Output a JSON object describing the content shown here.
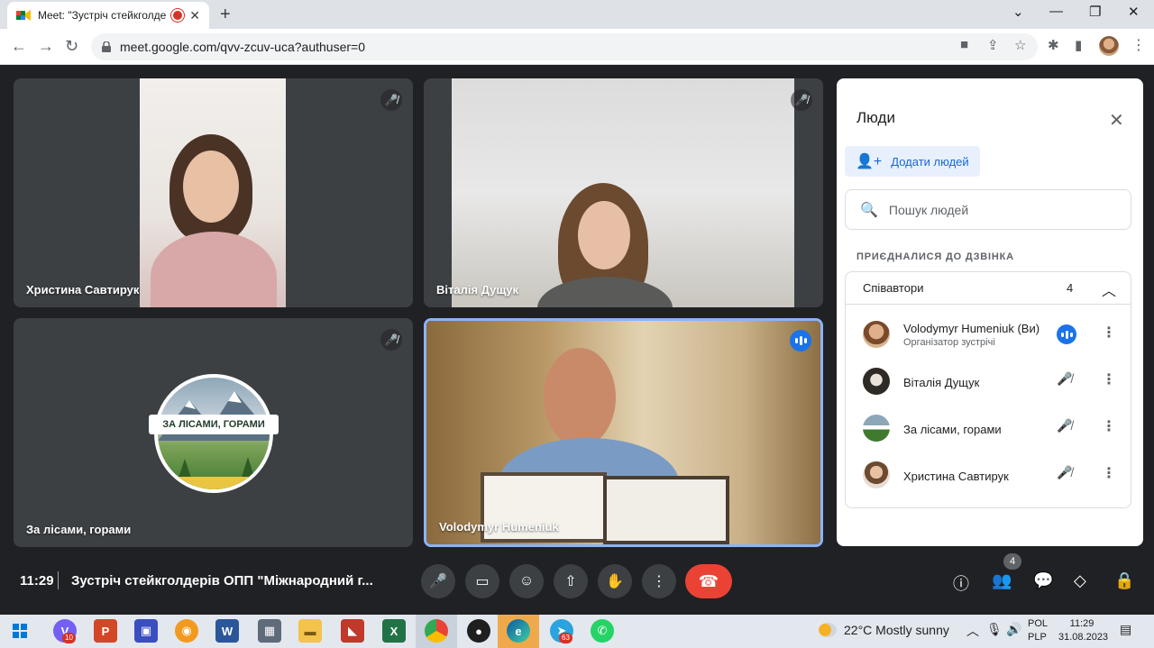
{
  "browser": {
    "tab_title": "Meet: \"Зустріч стейкголдер",
    "url": "meet.google.com/qvv-zcuv-uca?authuser=0"
  },
  "tiles": {
    "t1_name": "Христина Савтирук",
    "t2_name": "Віталія Дущук",
    "t3_name": "За лісами, горами",
    "t3_logo_text": "ЗА ЛІСАМИ, ГОРАМИ",
    "t4_name": "Volodymyr Humeniuk"
  },
  "panel": {
    "title": "Люди",
    "add_label": "Додати людей",
    "search_placeholder": "Пошук людей",
    "section_label": "ПРИЄДНАЛИСЯ ДО ДЗВІНКА",
    "group_name": "Співавтори",
    "group_count": "4",
    "people": [
      {
        "name": "Volodymyr Humeniuk (Ви)",
        "role": "Організатор зустрічі"
      },
      {
        "name": "Віталія Дущук"
      },
      {
        "name": "За лісами, горами"
      },
      {
        "name": "Христина Савтирук"
      }
    ]
  },
  "bottom": {
    "time": "11:29",
    "meeting_title": "Зустріч стейкголдерів ОПП \"Міжнародний г...",
    "people_count": "4"
  },
  "taskbar": {
    "viber_badge": "10",
    "telegram_badge": "63",
    "weather": "22°C  Mostly sunny",
    "lang_top": "POL",
    "lang_bottom": "PLP",
    "time": "11:29",
    "date": "31.08.2023"
  },
  "colors": {
    "accent": "#1a73e8",
    "end_call": "#ea4335",
    "meet_bg": "#202124",
    "tile_bg": "#3c4043"
  }
}
